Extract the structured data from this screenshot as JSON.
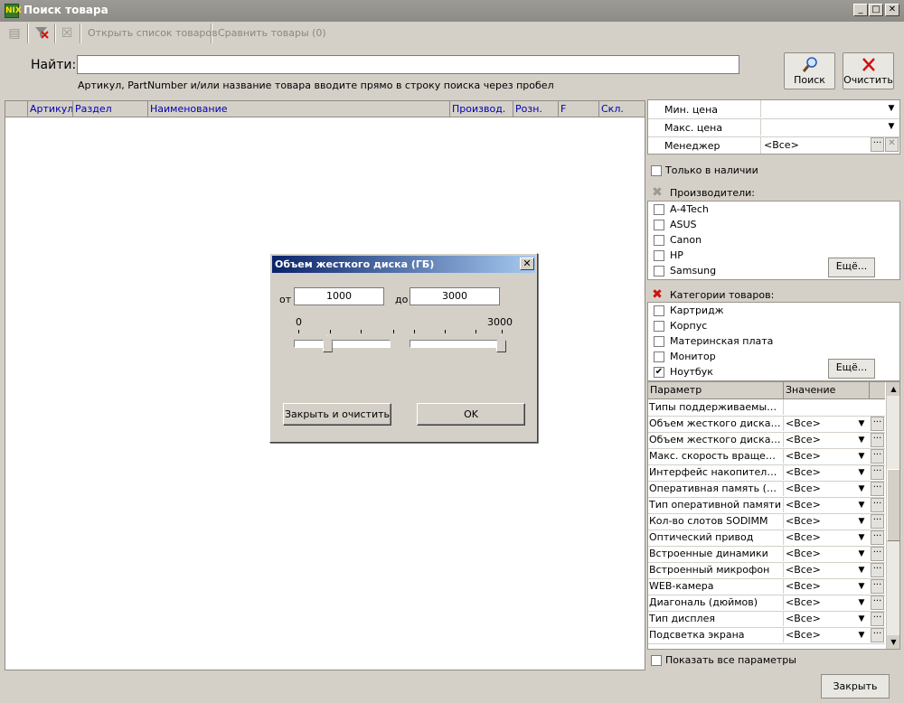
{
  "window": {
    "title": "Поиск товара",
    "app_icon": "NIX",
    "minimize": "_",
    "maximize": "□",
    "close": "✕"
  },
  "toolbar": {
    "open_list_label": "Открыть список товаров",
    "compare_label": "Сравнить товары (0)"
  },
  "search": {
    "label": "Найти:",
    "value": "",
    "hint": "Артикул, PartNumber и/или название товара вводите прямо в строку поиска через пробел",
    "search_button": "Поиск",
    "clear_button": "Очистить"
  },
  "grid": {
    "columns": [
      "Артикул",
      "Раздел",
      "Наименование",
      "Производ.",
      "Розн.",
      "F",
      "Скл."
    ]
  },
  "filters": {
    "min_price_label": "Мин. цена",
    "max_price_label": "Макс. цена",
    "manager_label": "Менеджер",
    "min_price_value": "",
    "max_price_value": "",
    "manager_value": "<Все>",
    "in_stock_label": "Только в наличии",
    "in_stock_checked": false
  },
  "manufacturers": {
    "title": "Производители:",
    "items": [
      {
        "label": "A-4Tech",
        "checked": false
      },
      {
        "label": "ASUS",
        "checked": false
      },
      {
        "label": "Canon",
        "checked": false
      },
      {
        "label": "HP",
        "checked": false
      },
      {
        "label": "Samsung",
        "checked": false
      }
    ],
    "more_button": "Ещё..."
  },
  "categories": {
    "title": "Категории товаров:",
    "items": [
      {
        "label": "Картридж",
        "checked": false
      },
      {
        "label": "Корпус",
        "checked": false
      },
      {
        "label": "Материнская плата",
        "checked": false
      },
      {
        "label": "Монитор",
        "checked": false
      },
      {
        "label": "Ноутбук",
        "checked": true
      }
    ],
    "more_button": "Ещё..."
  },
  "params": {
    "header_param": "Параметр",
    "header_value": "Значение",
    "rows": [
      {
        "name": "Типы поддерживаемых к...",
        "value": ""
      },
      {
        "name": "Объем жесткого диска (ГБ)",
        "value": "<Все>"
      },
      {
        "name": "Объем жесткого диска SS...",
        "value": "<Все>"
      },
      {
        "name": "Макс. скорость вращения...",
        "value": "<Все>"
      },
      {
        "name": "Интерфейс накопителя н...",
        "value": "<Все>"
      },
      {
        "name": "Оперативная память (МБ)",
        "value": "<Все>"
      },
      {
        "name": "Тип оперативной памяти",
        "value": "<Все>"
      },
      {
        "name": "Кол-во слотов SODIMM",
        "value": "<Все>"
      },
      {
        "name": "Оптический привод",
        "value": "<Все>"
      },
      {
        "name": "Встроенные динамики",
        "value": "<Все>"
      },
      {
        "name": "Встроенный микрофон",
        "value": "<Все>"
      },
      {
        "name": "WEB-камера",
        "value": "<Все>"
      },
      {
        "name": "Диагональ (дюймов)",
        "value": "<Все>"
      },
      {
        "name": "Тип дисплея",
        "value": "<Все>"
      },
      {
        "name": "Подсветка экрана",
        "value": "<Все>"
      }
    ],
    "show_all_label": "Показать все параметры",
    "show_all_checked": false
  },
  "footer": {
    "close_button": "Закрыть"
  },
  "dialog": {
    "title": "Объем жесткого диска (ГБ)",
    "from_label": "от",
    "to_label": "до",
    "from_value": "1000",
    "to_value": "3000",
    "min_label": "0",
    "max_label": "3000",
    "left_slider_fraction": 0.33,
    "right_slider_fraction": 1.0,
    "close_clear_button": "Закрыть и очистить",
    "ok_button": "OK"
  },
  "icons": {
    "search": "search-icon",
    "clear": "red-x-icon",
    "section_clear": "remove-filter-icon"
  },
  "colors": {
    "title_bar": "#8e8c86",
    "dialog_title": "#0a246a",
    "header_text": "#0000b4",
    "clear_red": "#d01010"
  }
}
